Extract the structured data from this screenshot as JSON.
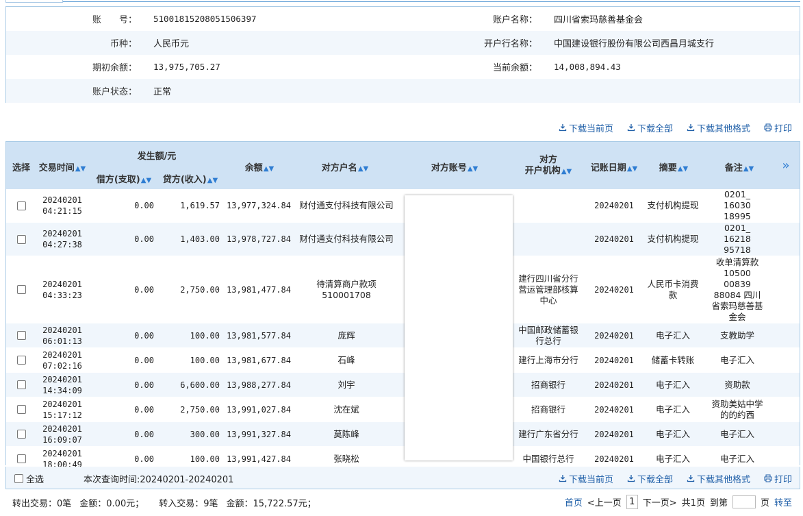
{
  "account": {
    "no_label": "账　　号：",
    "no_value": "51001815208051506397",
    "name_label": "账户名称：",
    "name_value": "四川省索玛慈善基金会",
    "currency_label": "币种：",
    "currency_value": "人民币元",
    "bank_label": "开户行名称：",
    "bank_value": "中国建设银行股份有限公司西昌月城支行",
    "open_bal_label": "期初余额：",
    "open_bal_value": "13,975,705.27",
    "cur_bal_label": "当前余额：",
    "cur_bal_value": "14,008,894.43",
    "status_label": "账户状态：",
    "status_value": "正常"
  },
  "toolbar": {
    "download_page": "下载当前页",
    "download_all": "下载全部",
    "download_other": "下载其他格式",
    "print": "打印"
  },
  "table": {
    "headers": {
      "select": "选择",
      "time": "交易时间",
      "amount_group": "发生额/元",
      "debit": "借方(支取)",
      "credit": "贷方(收入)",
      "balance": "余额",
      "cp_name": "对方户名",
      "cp_account": "对方账号",
      "cp_bank_1": "对方",
      "cp_bank_2": "开户机构",
      "post_date": "记账日期",
      "summary": "摘要",
      "remark": "备注",
      "more": "»"
    },
    "rows": [
      {
        "date": "20240201",
        "time": "04:21:15",
        "debit": "0.00",
        "credit": "1,619.57",
        "balance": "13,977,324.84",
        "cp_name": "财付通支付科技有限公司",
        "cp_bank": "",
        "post_date": "20240201",
        "summary": "支付机构提现",
        "remark": "0201_ 16030 18995"
      },
      {
        "date": "20240201",
        "time": "04:27:38",
        "debit": "0.00",
        "credit": "1,403.00",
        "balance": "13,978,727.84",
        "cp_name": "财付通支付科技有限公司",
        "cp_bank": "",
        "post_date": "20240201",
        "summary": "支付机构提现",
        "remark": "0201_ 16218 95718"
      },
      {
        "date": "20240201",
        "time": "04:33:23",
        "debit": "0.00",
        "credit": "2,750.00",
        "balance": "13,981,477.84",
        "cp_name": "待清算商户款项510001708",
        "cp_bank": "建行四川省分行营运管理部核算中心",
        "post_date": "20240201",
        "summary": "人民币卡消费款",
        "remark": "收单清算款 10500 00839 88084 四川省索玛慈善基金会"
      },
      {
        "date": "20240201",
        "time": "06:01:13",
        "debit": "0.00",
        "credit": "100.00",
        "balance": "13,981,577.84",
        "cp_name": "庞辉",
        "cp_bank": "中国邮政储蓄银行总行",
        "post_date": "20240201",
        "summary": "电子汇入",
        "remark": "支教助学"
      },
      {
        "date": "20240201",
        "time": "07:02:16",
        "debit": "0.00",
        "credit": "100.00",
        "balance": "13,981,677.84",
        "cp_name": "石峰",
        "cp_bank": "建行上海市分行",
        "post_date": "20240201",
        "summary": "储蓄卡转账",
        "remark": "电子汇入"
      },
      {
        "date": "20240201",
        "time": "14:34:09",
        "debit": "0.00",
        "credit": "6,600.00",
        "balance": "13,988,277.84",
        "cp_name": "刘宇",
        "cp_bank": "招商银行",
        "post_date": "20240201",
        "summary": "电子汇入",
        "remark": "资助款"
      },
      {
        "date": "20240201",
        "time": "15:17:12",
        "debit": "0.00",
        "credit": "2,750.00",
        "balance": "13,991,027.84",
        "cp_name": "沈在斌",
        "cp_bank": "招商银行",
        "post_date": "20240201",
        "summary": "电子汇入",
        "remark": "资助美姑中学的的约西"
      },
      {
        "date": "20240201",
        "time": "16:09:07",
        "debit": "0.00",
        "credit": "300.00",
        "balance": "13,991,327.84",
        "cp_name": "莫陈峰",
        "cp_bank": "建行广东省分行",
        "post_date": "20240201",
        "summary": "电子汇入",
        "remark": "电子汇入"
      },
      {
        "date": "20240201",
        "time": "18:00:49",
        "debit": "0.00",
        "credit": "100.00",
        "balance": "13,991,427.84",
        "cp_name": "张晓松",
        "cp_bank": "中国银行总行",
        "post_date": "20240201",
        "summary": "电子汇入",
        "remark": "电子汇入"
      }
    ]
  },
  "footer": {
    "select_all": "全选",
    "query_time": "本次查询时间:20240201-20240201",
    "out_tx": "转出交易：0笔",
    "out_amt": "金额：0.00元；",
    "in_tx": "转入交易：9笔",
    "in_amt": "金额：15,722.57元；",
    "first": "首页",
    "prev": "<上一页",
    "page": "1",
    "next": "下一页>",
    "total": "共1页",
    "goto": "到第",
    "page_unit": "页",
    "jump": "转至"
  }
}
